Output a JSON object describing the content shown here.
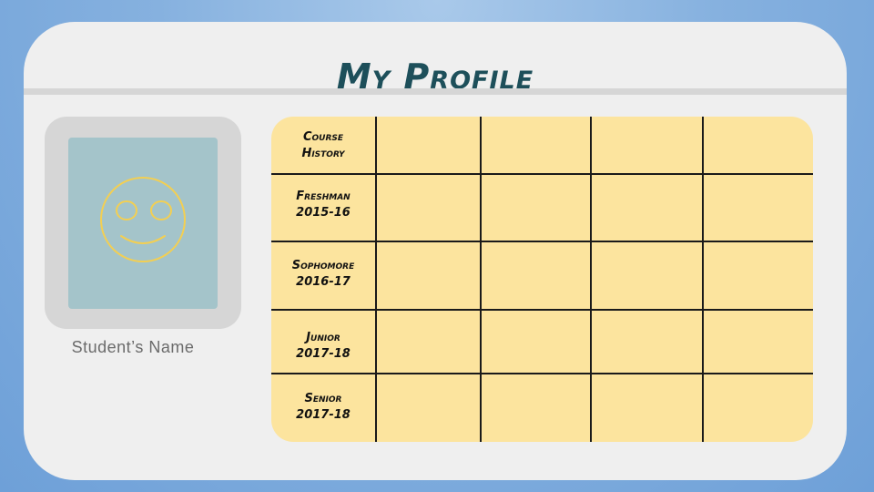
{
  "title": "My Profile",
  "profile": {
    "student_name": "Student’s Name",
    "avatar_icon": "smiley-face-icon"
  },
  "course_table": {
    "rows": [
      {
        "line1": "Course",
        "line2": "History"
      },
      {
        "line1": "Freshman",
        "line2": "2015-16"
      },
      {
        "line1": "Sophomore",
        "line2": "2016-17"
      },
      {
        "line1": "Junior",
        "line2": "2017-18"
      },
      {
        "line1": "Senior",
        "line2": "2017-18"
      }
    ]
  },
  "colors": {
    "background": "#7aa9dc",
    "card": "#efefef",
    "title": "#1d4f5a",
    "photo": "#a4c4ca",
    "smiley": "#f3cf52",
    "table": "#fce49e"
  }
}
